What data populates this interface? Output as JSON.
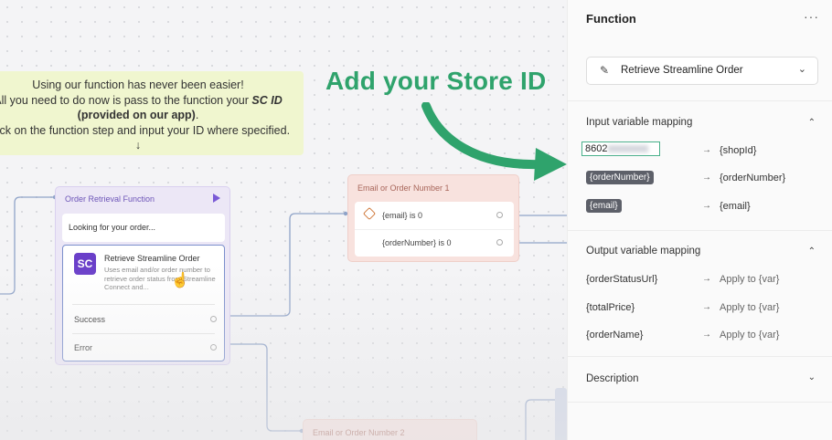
{
  "canvas": {
    "note_lines": {
      "line1": "Using our function has never been easier!",
      "line2_pre": "All you need to do now is pass to the function your ",
      "line2_em": "SC ID",
      "line3_bold": "(provided on our app)",
      "line3_post": ".",
      "line4": "Click on the function step and input your ID where specified.",
      "line5": "↓"
    },
    "headline": "Add your Store ID",
    "order_node": {
      "title": "Order Retrieval Function",
      "message": "Looking for your order...",
      "function_title": "Retrieve Streamline Order",
      "function_desc": "Uses email and/or order number to retrieve order status from Streamline Connect and...",
      "logo_text": "SC",
      "success_label": "Success",
      "error_label": "Error"
    },
    "condition_node": {
      "title": "Email or Order Number 1",
      "conditions": [
        "{email} is 0",
        "{orderNumber} is 0"
      ]
    },
    "condition_node_2": {
      "title": "Email or Order Number 2"
    }
  },
  "panel": {
    "title": "Function",
    "more_icon": "more-dots-icon",
    "selected_function": "Retrieve Streamline Order",
    "input_section": {
      "title": "Input variable mapping",
      "rows": [
        {
          "source": "8602",
          "target": "{shopId}"
        },
        {
          "source": "{orderNumber}",
          "target": "{orderNumber}"
        },
        {
          "source": "{email}",
          "target": "{email}"
        }
      ]
    },
    "output_section": {
      "title": "Output variable mapping",
      "rows": [
        {
          "source": "{orderStatusUrl}",
          "target": "Apply to {var}"
        },
        {
          "source": "{totalPrice}",
          "target": "Apply to {var}"
        },
        {
          "source": "{orderName}",
          "target": "Apply to {var}"
        }
      ]
    },
    "description_section": {
      "title": "Description"
    }
  },
  "colors": {
    "accent_green": "#2fa36c",
    "node_purple": "#ece7f6",
    "node_red": "#f8e2de",
    "pill_gray": "#5d6069",
    "note_yellow": "#f0f6cf"
  }
}
